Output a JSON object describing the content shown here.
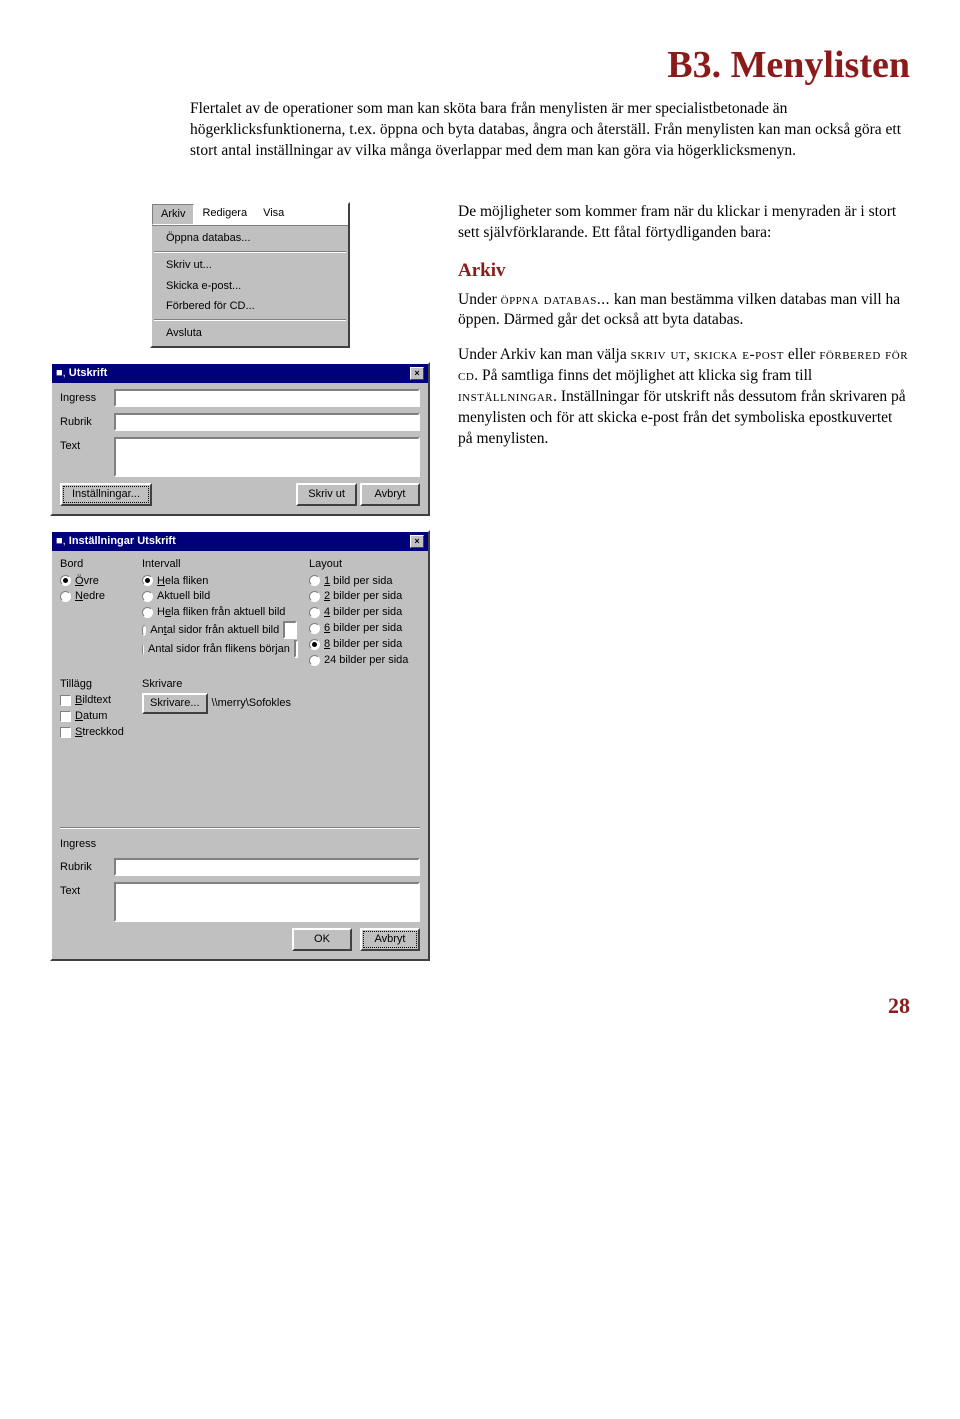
{
  "title": "B3. Menylisten",
  "intro": "Flertalet av de operationer som man kan sköta bara från menylisten är mer specialistbetonade än högerklicksfunktionerna, t.ex. öppna och byta databas, ångra och återställ. Från menylisten kan man också göra ett stort antal inställningar av vilka många överlappar med dem man kan göra via högerklicksmenyn.",
  "right": {
    "p1": "De möjligheter som kommer fram när du klickar i menyraden är i stort sett självförklarande. Ett fåtal förtydliganden bara:",
    "h_arkiv": "Arkiv",
    "p2a": "Under ",
    "p2_sc": "öppna databas...",
    "p2b": " kan man bestämma vilken databas man vill ha öppen. Därmed går det också att byta databas.",
    "p3a": "Under Arkiv kan man välja ",
    "p3_sc1": "skriv ut",
    "p3b": ", ",
    "p3_sc2": "skicka e-post",
    "p3c": " eller ",
    "p3_sc3": "förbered för cd",
    "p3d": ". På samtliga finns det möjlighet att klicka sig fram till ",
    "p3_sc4": "inställningar",
    "p3e": ". Inställningar för utskrift nås dessutom från skrivaren på menylisten och för att skicka e-post från det symboliska epostkuvertet på menylisten."
  },
  "menu": {
    "bar": {
      "arkiv": "Arkiv",
      "redigera": "Redigera",
      "visa": "Visa"
    },
    "items": {
      "open": "Öppna databas...",
      "print": "Skriv ut...",
      "email": "Skicka e-post...",
      "cd": "Förbered för CD...",
      "exit": "Avsluta"
    }
  },
  "dlg_print": {
    "title": "Utskrift",
    "ingress": "Ingress",
    "rubrik": "Rubrik",
    "text": "Text",
    "settings_btn": "Inställningar...",
    "print_btn": "Skriv ut",
    "cancel_btn": "Avbryt"
  },
  "dlg_settings": {
    "title": "Inställningar Utskrift",
    "bord": {
      "title": "Bord",
      "ovre": "Övre",
      "nedre": "Nedre"
    },
    "intervall": {
      "title": "Intervall",
      "o1": "Hela fliken",
      "o2": "Aktuell bild",
      "o3": "Hela fliken från aktuell bild",
      "o4": "Antal sidor från aktuell bild",
      "o5": "Antal sidor från flikens början"
    },
    "layout": {
      "title": "Layout",
      "o1": "1 bild per sida",
      "o2": "2 bilder per sida",
      "o3": "4 bilder per sida",
      "o4": "6 bilder per sida",
      "o5": "8 bilder per sida",
      "o6": "24 bilder per sida"
    },
    "tillagg": {
      "title": "Tillägg",
      "o1": "Bildtext",
      "o2": "Datum",
      "o3": "Streckkod"
    },
    "skrivare": {
      "title": "Skrivare",
      "btn": "Skrivare...",
      "path": "\\\\merry\\Sofokles"
    },
    "ingress": "Ingress",
    "rubrik": "Rubrik",
    "text": "Text",
    "ok_btn": "OK",
    "cancel_btn": "Avbryt"
  },
  "page_number": "28"
}
